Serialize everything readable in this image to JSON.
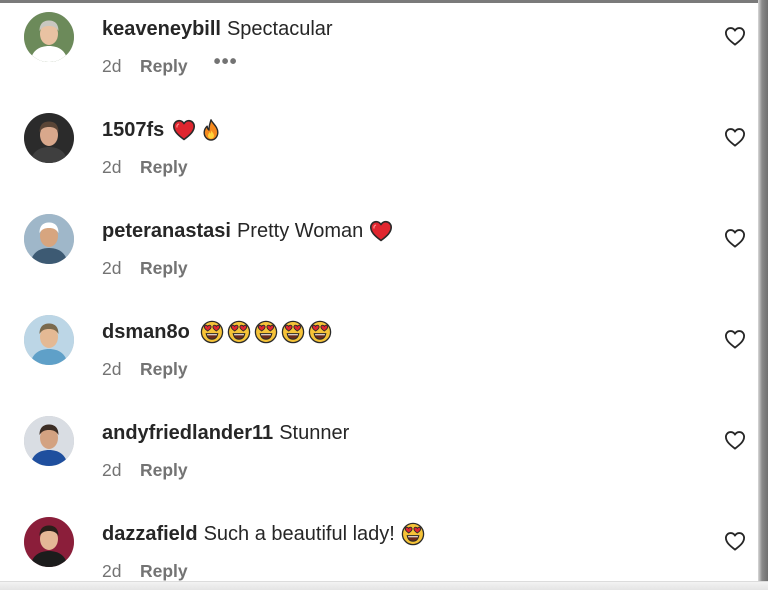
{
  "comments": [
    {
      "username": "keaveneybill",
      "text": "Spectacular",
      "emojis": [],
      "age": "2d",
      "reply_label": "Reply",
      "more_label": "•••",
      "show_more": true,
      "avatar_colors": {
        "bg": "#6c8a5a",
        "face": "#e9c2a2",
        "hair": "#c9c7c0",
        "shirt": "#ffffff"
      }
    },
    {
      "username": "1507fs",
      "text": "",
      "emojis": [
        "red-heart",
        "fire"
      ],
      "age": "2d",
      "reply_label": "Reply",
      "show_more": false,
      "avatar_colors": {
        "bg": "#2b2b2b",
        "face": "#d9a88c",
        "hair": "#5a4536",
        "shirt": "#3f3f3f"
      }
    },
    {
      "username": "peteranastasi",
      "text": "Pretty Woman",
      "emojis": [
        "red-heart"
      ],
      "age": "2d",
      "reply_label": "Reply",
      "show_more": false,
      "avatar_colors": {
        "bg": "#9fb7c9",
        "face": "#d7a57f",
        "hair": "#ffffff",
        "shirt": "#3d5a73"
      }
    },
    {
      "username": "dsman8o",
      "text": "",
      "emojis": [
        "heart-eyes",
        "heart-eyes",
        "heart-eyes",
        "heart-eyes",
        "heart-eyes"
      ],
      "age": "2d",
      "reply_label": "Reply",
      "show_more": false,
      "avatar_colors": {
        "bg": "#bcd6e6",
        "face": "#e4b994",
        "hair": "#7a6a4e",
        "shirt": "#5fa0c8"
      }
    },
    {
      "username": "andyfriedlander11",
      "text": "Stunner",
      "emojis": [],
      "age": "2d",
      "reply_label": "Reply",
      "show_more": false,
      "avatar_colors": {
        "bg": "#d9dde3",
        "face": "#d3a281",
        "hair": "#3b2d24",
        "shirt": "#1f4f9e"
      }
    },
    {
      "username": "dazzafield",
      "text": "Such a beautiful lady!",
      "emojis": [
        "heart-eyes"
      ],
      "age": "2d",
      "reply_label": "Reply",
      "show_more": false,
      "avatar_colors": {
        "bg": "#8b1e3a",
        "face": "#e4b896",
        "hair": "#2a1f1a",
        "shirt": "#1c1c1c"
      }
    }
  ],
  "icons": {
    "like": "heart-outline-icon"
  },
  "colors": {
    "text": "#262626",
    "secondary": "#737373",
    "heart": "#e0262f",
    "emoji_face": "#f6c338"
  }
}
